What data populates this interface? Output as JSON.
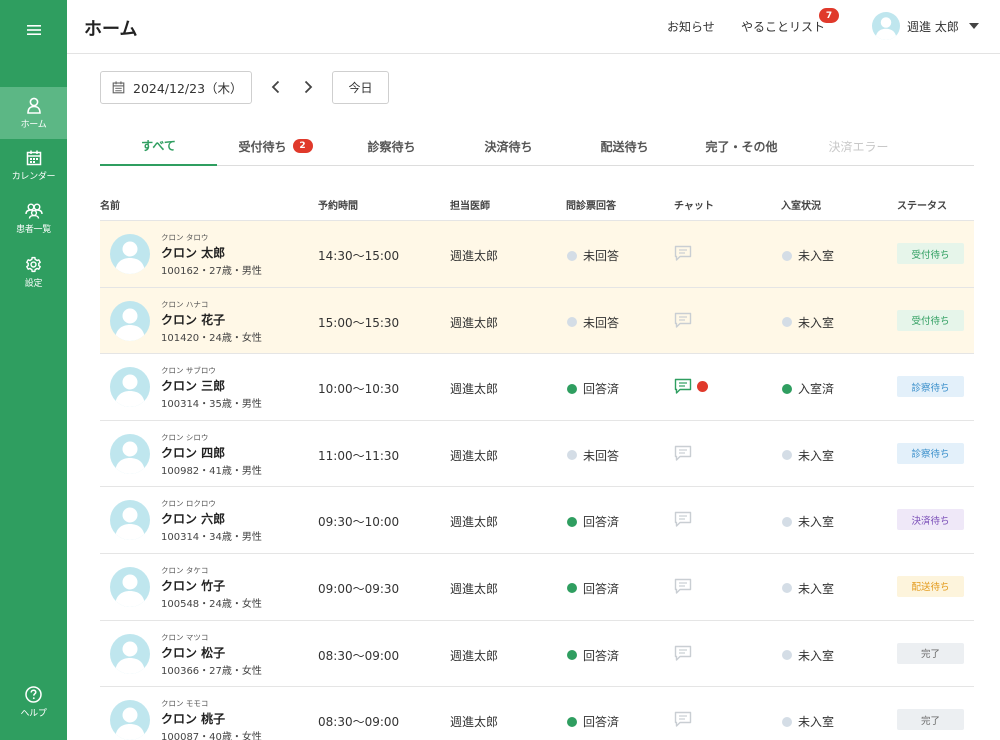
{
  "sidebar": {
    "items": [
      {
        "label": "ホーム",
        "icon": "home-user-icon"
      },
      {
        "label": "カレンダー",
        "icon": "calendar-icon"
      },
      {
        "label": "患者一覧",
        "icon": "patients-icon"
      },
      {
        "label": "設定",
        "icon": "gear-icon"
      }
    ],
    "help_label": "ヘルプ"
  },
  "header": {
    "title": "ホーム",
    "notifications_label": "お知らせ",
    "todo_label": "やることリスト",
    "todo_count": "7",
    "user_name": "週進 太郎"
  },
  "toolbar": {
    "date": "2024/12/23（木）",
    "today_label": "今日"
  },
  "tabs": [
    {
      "label": "すべて",
      "badge": ""
    },
    {
      "label": "受付待ち",
      "badge": "2"
    },
    {
      "label": "診察待ち",
      "badge": ""
    },
    {
      "label": "決済待ち",
      "badge": ""
    },
    {
      "label": "配送待ち",
      "badge": ""
    },
    {
      "label": "完了・その他",
      "badge": ""
    },
    {
      "label": "決済エラー",
      "badge": ""
    }
  ],
  "table": {
    "headers": [
      "名前",
      "予約時間",
      "担当医師",
      "問診票回答",
      "チャット",
      "入室状況",
      "ステータス"
    ],
    "rows": [
      {
        "kana": "クロン タロウ",
        "name": "クロン 太郎",
        "info": "100162・27歳・男性",
        "time": "14:30〜15:00",
        "doctor": "週進太郎",
        "questionnaire": "未回答",
        "q_done": false,
        "chat_active": false,
        "unread": false,
        "room": "未入室",
        "room_in": false,
        "status": "受付待ち",
        "status_type": "uketsuke"
      },
      {
        "kana": "クロン ハナコ",
        "name": "クロン 花子",
        "info": "101420・24歳・女性",
        "time": "15:00〜15:30",
        "doctor": "週進太郎",
        "questionnaire": "未回答",
        "q_done": false,
        "chat_active": false,
        "unread": false,
        "room": "未入室",
        "room_in": false,
        "status": "受付待ち",
        "status_type": "uketsuke"
      },
      {
        "kana": "クロン サブロウ",
        "name": "クロン 三郎",
        "info": "100314・35歳・男性",
        "time": "10:00〜10:30",
        "doctor": "週進太郎",
        "questionnaire": "回答済",
        "q_done": true,
        "chat_active": true,
        "unread": true,
        "room": "入室済",
        "room_in": true,
        "status": "診察待ち",
        "status_type": "shinsatsu"
      },
      {
        "kana": "クロン シロウ",
        "name": "クロン 四郎",
        "info": "100982・41歳・男性",
        "time": "11:00〜11:30",
        "doctor": "週進太郎",
        "questionnaire": "未回答",
        "q_done": false,
        "chat_active": false,
        "unread": false,
        "room": "未入室",
        "room_in": false,
        "status": "診察待ち",
        "status_type": "shinsatsu"
      },
      {
        "kana": "クロン ロクロウ",
        "name": "クロン 六郎",
        "info": "100314・34歳・男性",
        "time": "09:30〜10:00",
        "doctor": "週進太郎",
        "questionnaire": "回答済",
        "q_done": true,
        "chat_active": false,
        "unread": false,
        "room": "未入室",
        "room_in": false,
        "status": "決済待ち",
        "status_type": "kessai"
      },
      {
        "kana": "クロン タケコ",
        "name": "クロン 竹子",
        "info": "100548・24歳・女性",
        "time": "09:00〜09:30",
        "doctor": "週進太郎",
        "questionnaire": "回答済",
        "q_done": true,
        "chat_active": false,
        "unread": false,
        "room": "未入室",
        "room_in": false,
        "status": "配送待ち",
        "status_type": "haisou"
      },
      {
        "kana": "クロン マツコ",
        "name": "クロン 松子",
        "info": "100366・27歳・女性",
        "time": "08:30〜09:00",
        "doctor": "週進太郎",
        "questionnaire": "回答済",
        "q_done": true,
        "chat_active": false,
        "unread": false,
        "room": "未入室",
        "room_in": false,
        "status": "完了",
        "status_type": "kanryou"
      },
      {
        "kana": "クロン モモコ",
        "name": "クロン 桃子",
        "info": "100087・40歳・女性",
        "time": "08:30〜09:00",
        "doctor": "週進太郎",
        "questionnaire": "回答済",
        "q_done": true,
        "chat_active": false,
        "unread": false,
        "room": "未入室",
        "room_in": false,
        "status": "完了",
        "status_type": "kanryou"
      }
    ]
  },
  "colors": {
    "brand": "#2f9e60",
    "sidebar_active": "#5cb785",
    "badge_red": "#e0392b",
    "pending_row": "#fff8e7"
  }
}
